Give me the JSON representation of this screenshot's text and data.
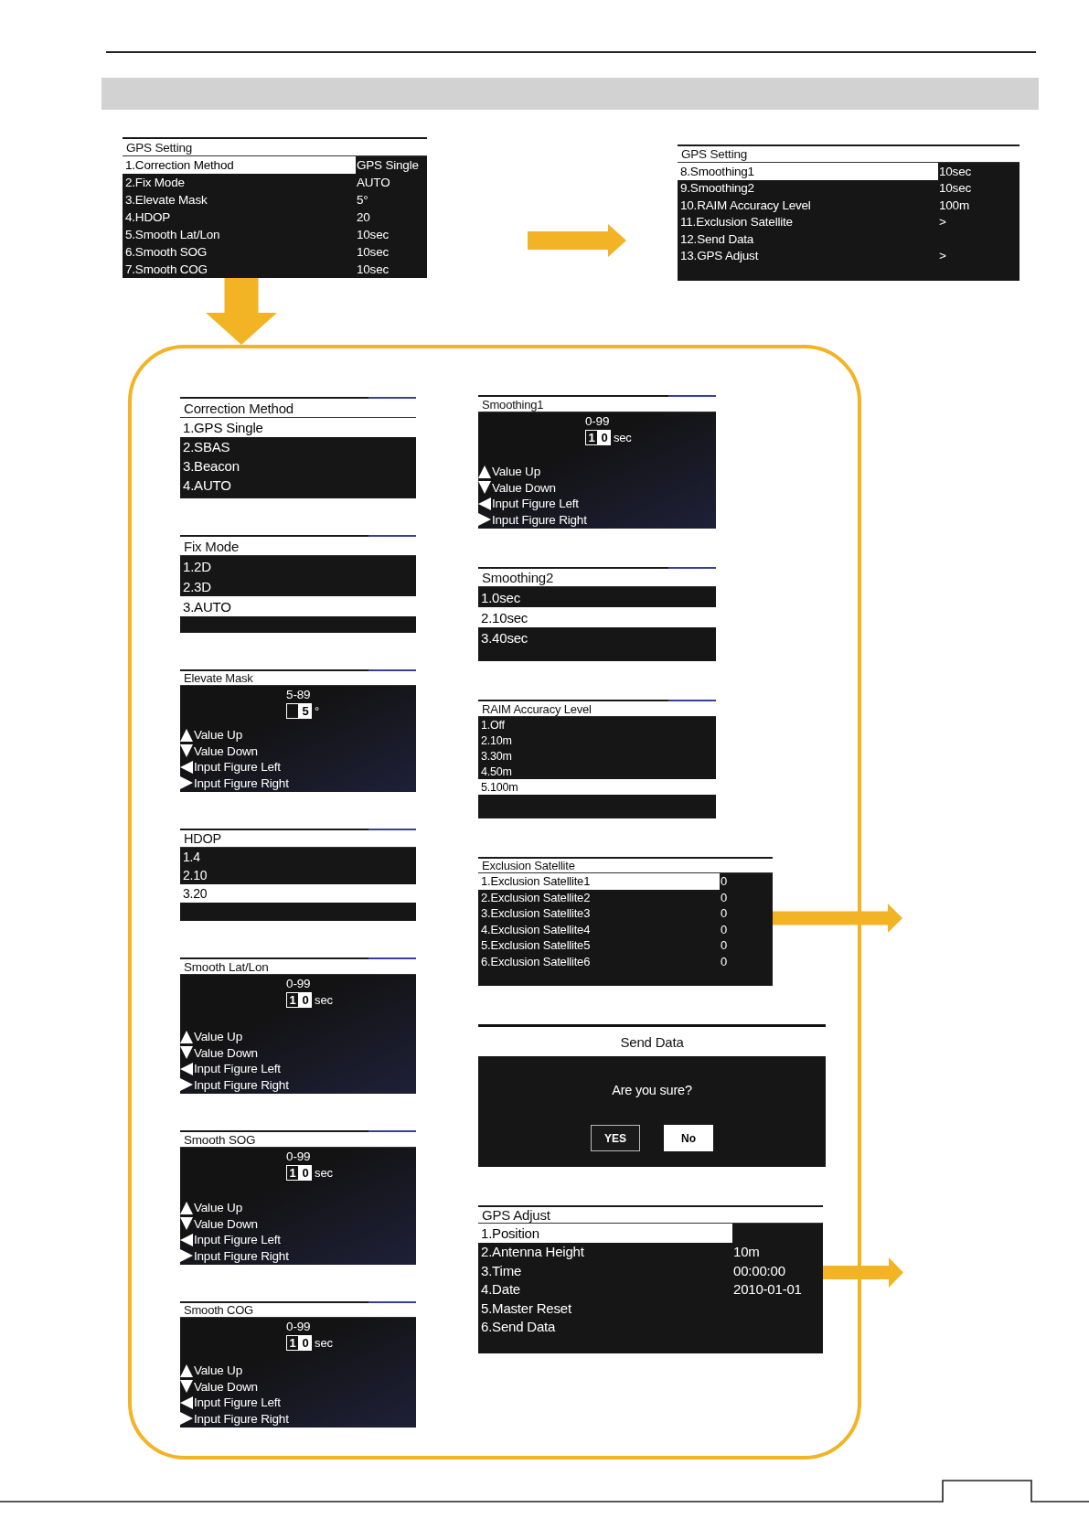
{
  "top_flow": [
    {
      "kind": "menu",
      "title": "GPS Setting",
      "rows": [
        {
          "label": "1.Correction Method",
          "value": "GPS Single",
          "selected": true
        },
        {
          "label": "2.Fix Mode",
          "value": "AUTO",
          "selected": false
        },
        {
          "label": "3.Elevate Mask",
          "value": "5°",
          "selected": false
        },
        {
          "label": "4.HDOP",
          "value": "20",
          "selected": false
        },
        {
          "label": "5.Smooth Lat/Lon",
          "value": "10sec",
          "selected": false
        },
        {
          "label": "6.Smooth SOG",
          "value": "10sec",
          "selected": false
        },
        {
          "label": "7.Smooth COG",
          "value": "10sec",
          "selected": false
        }
      ]
    },
    {
      "kind": "menu",
      "title": "GPS Setting",
      "rows": [
        {
          "label": "8.Smoothing1",
          "value": "10sec",
          "selected": true
        },
        {
          "label": "9.Smoothing2",
          "value": "10sec",
          "selected": false
        },
        {
          "label": "10.RAIM Accuracy Level",
          "value": "100m",
          "selected": false
        },
        {
          "label": "11.Exclusion Satellite",
          "value": ">",
          "selected": false
        },
        {
          "label": "12.Send Data",
          "selected": false
        },
        {
          "label": "13.GPS Adjust",
          "value": ">",
          "selected": false
        }
      ]
    }
  ],
  "detail_panel": {
    "left_column": [
      {
        "kind": "menu",
        "title": "Correction Method",
        "rows": [
          {
            "label": "1.GPS Single",
            "selected": true
          },
          {
            "label": "2.SBAS",
            "selected": false
          },
          {
            "label": "3.Beacon",
            "selected": false
          },
          {
            "label": "4.AUTO",
            "selected": false
          }
        ]
      },
      {
        "kind": "menu",
        "title": "Fix Mode",
        "rows": [
          {
            "label": "1.2D",
            "selected": false
          },
          {
            "label": "2.3D",
            "selected": false
          },
          {
            "label": "3.AUTO",
            "selected": true
          }
        ]
      },
      {
        "kind": "value_input",
        "title": "Elevate Mask",
        "range": "5-89",
        "digits": [
          {
            "selected": false
          },
          {
            "text": "5",
            "selected": true
          }
        ],
        "unit": "°",
        "hints": [
          {
            "kind": "up",
            "label": "Value Up"
          },
          {
            "kind": "down",
            "label": "Value Down"
          },
          {
            "kind": "left",
            "label": "Input Figure Left"
          },
          {
            "kind": "right",
            "label": "Input Figure Right"
          }
        ]
      },
      {
        "kind": "menu",
        "title": "HDOP",
        "rows": [
          {
            "label": "1.4",
            "selected": false
          },
          {
            "label": "2.10",
            "selected": false
          },
          {
            "label": "3.20",
            "selected": true
          }
        ]
      },
      {
        "kind": "value_input",
        "title": "Smooth Lat/Lon",
        "range": "0-99",
        "digits": [
          {
            "text": "1",
            "selected": false
          },
          {
            "text": "0",
            "selected": true
          }
        ],
        "unit": "sec",
        "hints": [
          {
            "kind": "up",
            "label": "Value Up"
          },
          {
            "kind": "down",
            "label": "Value Down"
          },
          {
            "kind": "left",
            "label": "Input Figure Left"
          },
          {
            "kind": "right",
            "label": "Input Figure Right"
          }
        ]
      },
      {
        "kind": "value_input",
        "title": "Smooth SOG",
        "range": "0-99",
        "digits": [
          {
            "text": "1",
            "selected": false
          },
          {
            "text": "0",
            "selected": true
          }
        ],
        "unit": "sec",
        "hints": [
          {
            "kind": "up",
            "label": "Value Up"
          },
          {
            "kind": "down",
            "label": "Value Down"
          },
          {
            "kind": "left",
            "label": "Input Figure Left"
          },
          {
            "kind": "right",
            "label": "Input Figure Right"
          }
        ]
      },
      {
        "kind": "value_input",
        "title": "Smooth COG",
        "range": "0-99",
        "digits": [
          {
            "text": "1",
            "selected": false
          },
          {
            "text": "0",
            "selected": true
          }
        ],
        "unit": "sec",
        "hints": [
          {
            "kind": "up",
            "label": "Value Up"
          },
          {
            "kind": "down",
            "label": "Value Down"
          },
          {
            "kind": "left",
            "label": "Input Figure Left"
          },
          {
            "kind": "right",
            "label": "Input Figure Right"
          }
        ]
      }
    ],
    "right_column": [
      {
        "kind": "value_input",
        "title": "Smoothing1",
        "range": "0-99",
        "digits": [
          {
            "text": "1",
            "selected": false
          },
          {
            "text": "0",
            "selected": true
          }
        ],
        "unit": "sec",
        "hints": [
          {
            "kind": "up",
            "label": "Value Up"
          },
          {
            "kind": "down",
            "label": "Value Down"
          },
          {
            "kind": "left",
            "label": "Input Figure Left"
          },
          {
            "kind": "right",
            "label": "Input Figure Right"
          }
        ]
      },
      {
        "kind": "menu",
        "title": "Smoothing2",
        "rows": [
          {
            "label": "1.0sec",
            "selected": false
          },
          {
            "label": "2.10sec",
            "selected": true
          },
          {
            "label": "3.40sec",
            "selected": false
          }
        ]
      },
      {
        "kind": "menu",
        "title": "RAIM Accuracy Level",
        "rows": [
          {
            "label": "1.Off",
            "selected": false
          },
          {
            "label": "2.10m",
            "selected": false
          },
          {
            "label": "3.30m",
            "selected": false
          },
          {
            "label": "4.50m",
            "selected": false
          },
          {
            "label": "5.100m",
            "selected": true
          }
        ]
      },
      {
        "kind": "menu",
        "title": "Exclusion Satellite",
        "rows": [
          {
            "label": "1.Exclusion Satellite1",
            "value": "0",
            "selected": true
          },
          {
            "label": "2.Exclusion Satellite2",
            "value": "0",
            "selected": false
          },
          {
            "label": "3.Exclusion Satellite3",
            "value": "0",
            "selected": false
          },
          {
            "label": "4.Exclusion Satellite4",
            "value": "0",
            "selected": false
          },
          {
            "label": "5.Exclusion Satellite5",
            "value": "0",
            "selected": false
          },
          {
            "label": "6.Exclusion Satellite6",
            "value": "0",
            "selected": false
          }
        ]
      },
      {
        "kind": "confirm",
        "title": "Send Data",
        "message": "Are you sure?",
        "buttons": [
          {
            "label": "YES",
            "selected": false
          },
          {
            "label": "No",
            "selected": true
          }
        ]
      },
      {
        "kind": "menu",
        "title": "GPS Adjust",
        "rows": [
          {
            "label": "1.Position",
            "selected": true
          },
          {
            "label": "2.Antenna Height",
            "value": "10m",
            "selected": false
          },
          {
            "label": "3.Time",
            "value": "00:00:00",
            "selected": false
          },
          {
            "label": "4.Date",
            "value": "2010-01-01",
            "selected": false
          },
          {
            "label": "5.Master Reset",
            "selected": false
          },
          {
            "label": "6.Send Data",
            "selected": false
          }
        ]
      }
    ]
  }
}
